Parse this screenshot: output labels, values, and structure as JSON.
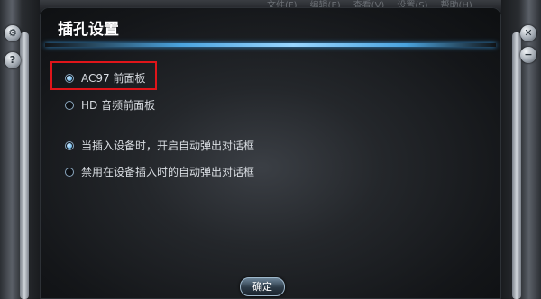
{
  "host_menu": [
    "文件(F)",
    "编辑(E)",
    "查看(V)",
    "设置(S)",
    "帮助(H)"
  ],
  "dialog": {
    "title": "插孔设置",
    "panel_options": [
      {
        "label": "AC97 前面板",
        "selected": true
      },
      {
        "label": "HD 音频前面板",
        "selected": false
      }
    ],
    "popup_options": [
      {
        "label": "当插入设备时，开启自动弹出对话框",
        "selected": true
      },
      {
        "label": "禁用在设备插入时的自动弹出对话框",
        "selected": false
      }
    ],
    "ok_label": "确定"
  },
  "colors": {
    "accent": "#4aa3de",
    "highlight_box": "#e0151a",
    "panel": "#1a1c1f"
  },
  "icons": {
    "left_top": "gear-icon",
    "left_second": "help-icon",
    "right_top": "close-icon",
    "right_second": "minimize-icon"
  }
}
